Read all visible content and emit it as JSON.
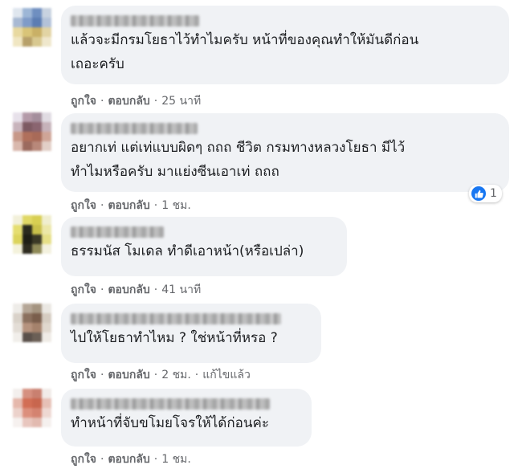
{
  "actions": {
    "like": "ถูกใจ",
    "reply": "ตอบกลับ",
    "separator": "·"
  },
  "comments": [
    {
      "text": "แล้วจะมีกรมโยธาไว้ทำไมครับ หน้าที่ของคุณทำให้มันดีก่อน\nเถอะครับ",
      "time": "25 นาที"
    },
    {
      "text": "อยากเท่ แต่เท่แบบผิดๆ ถถถ ชีวิต กรมทางหลวงโยธา มีไว้\nทำไมหรือครับ มาแย่งซีนเอาเท่ ถถถ",
      "time": "1 ชม.",
      "reaction": {
        "icon": "like-icon",
        "count": "1"
      }
    },
    {
      "text": "ธรรมนัส โมเดล ทำดีเอาหน้า(หรือเปล่า)",
      "time": "41 นาที"
    },
    {
      "text": "ไปให้โยธาทำไหม ? ใช่หน้าที่หรอ ?",
      "time": "2 ชม.",
      "edited": "แก้ไขแล้ว"
    },
    {
      "text": "ทำหน้าที่จับขโมยโจรให้ได้ก่อนค่ะ",
      "time": "1 ชม."
    }
  ],
  "colors": {
    "bubble": "#f0f2f5",
    "meta": "#65676b",
    "text": "#1c1e21",
    "like_blue": "#1877f2"
  }
}
